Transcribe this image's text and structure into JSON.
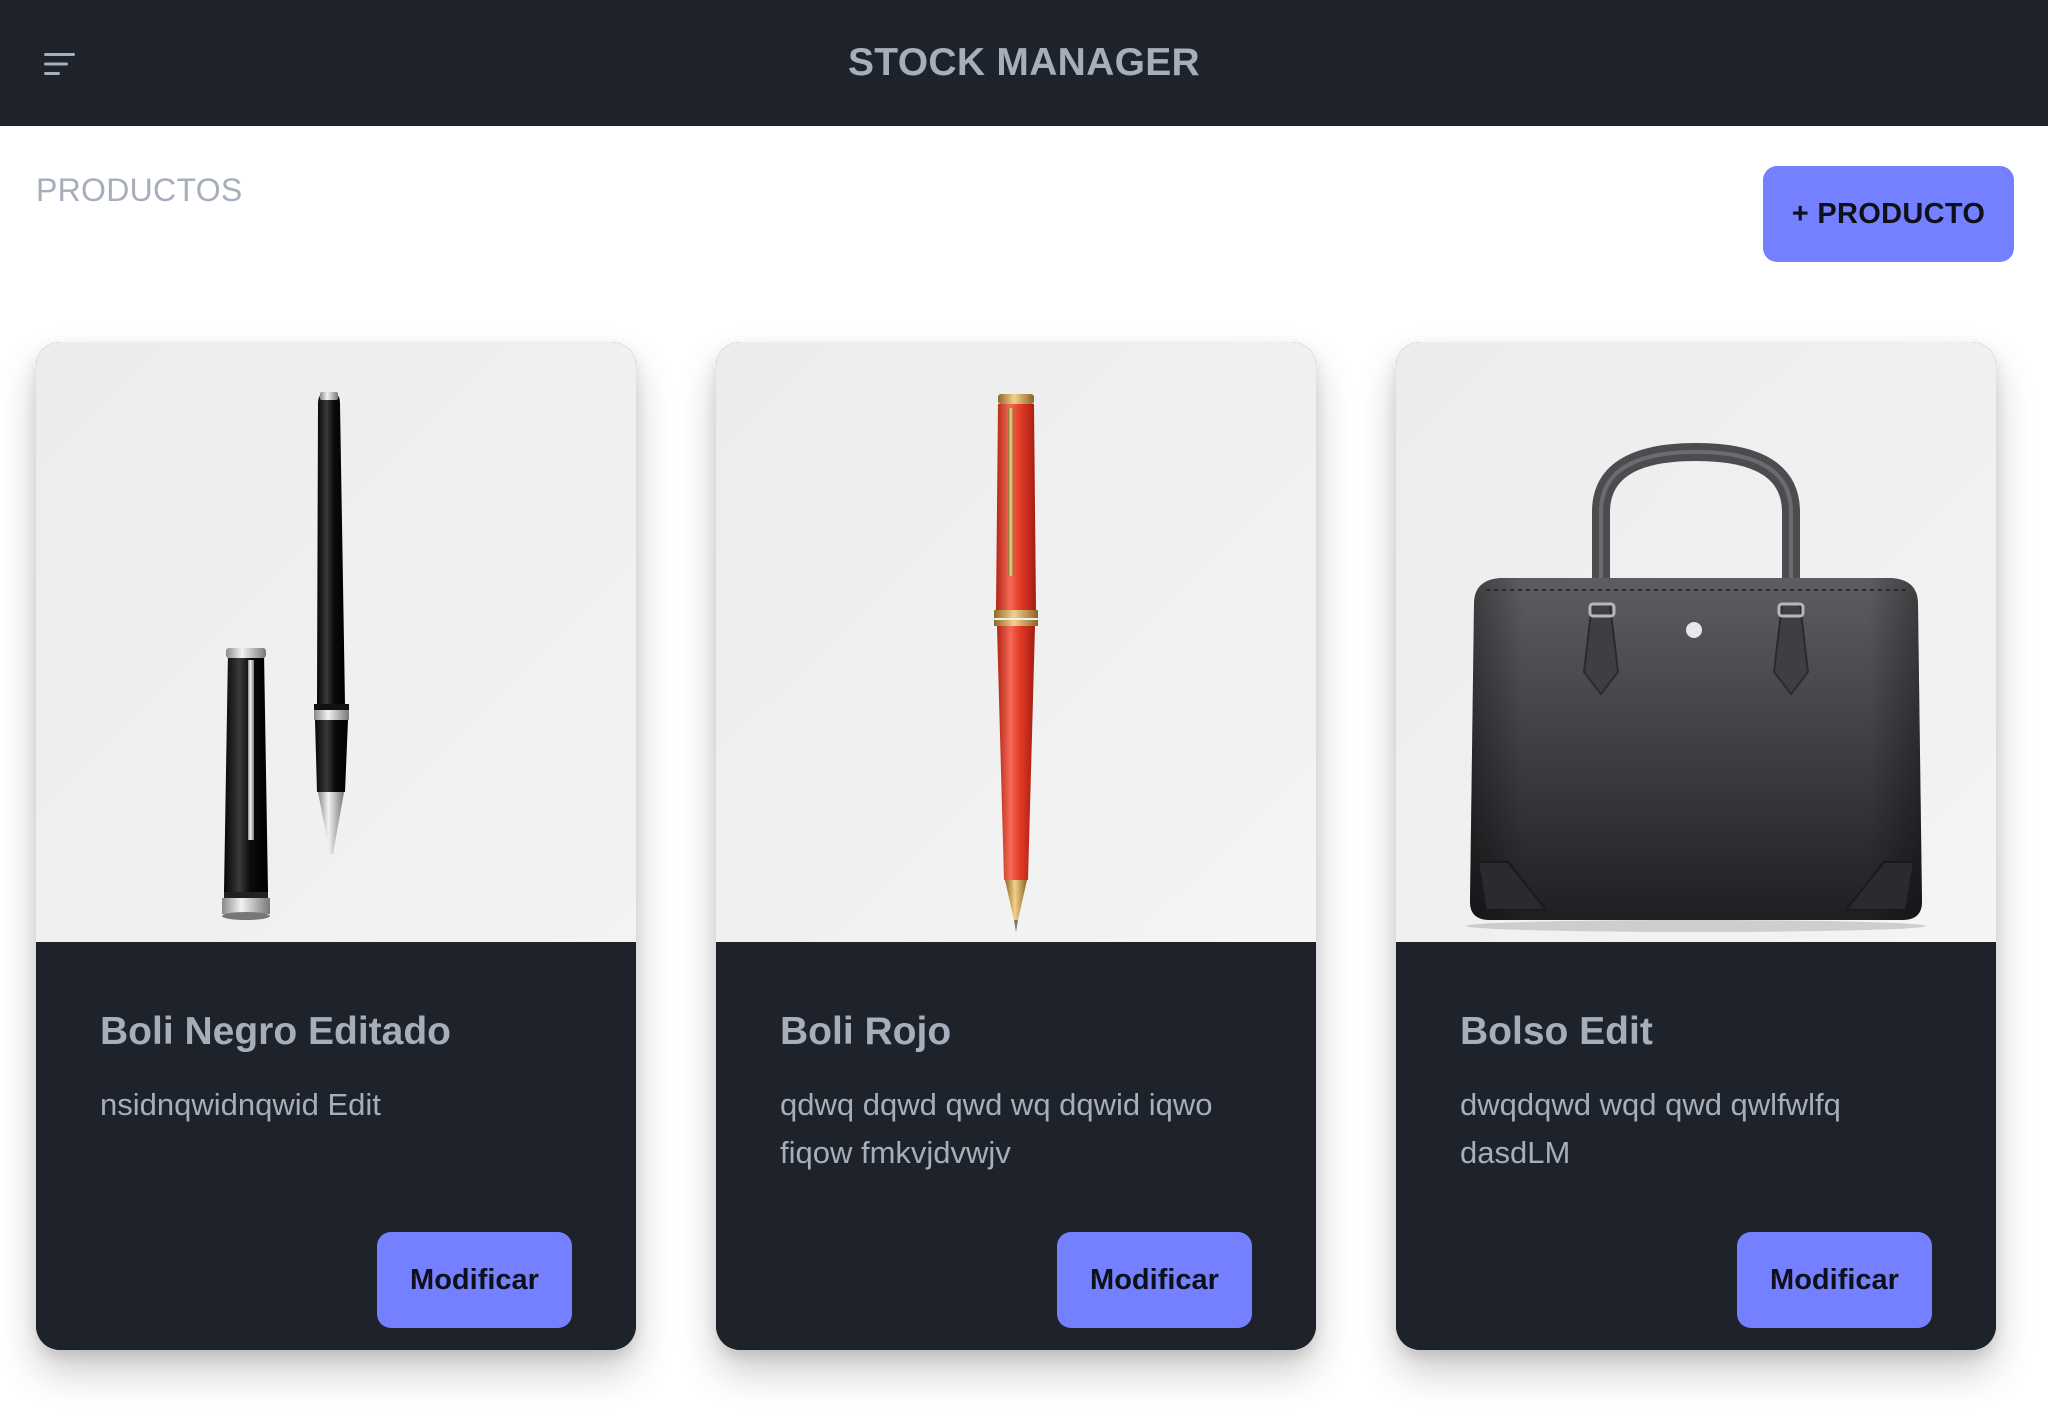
{
  "header": {
    "title": "STOCK MANAGER",
    "menu_icon": "menu-icon",
    "background": "#1d222b"
  },
  "page": {
    "section_title": "PRODUCTOS",
    "add_button_label": "+ PRODUCTO"
  },
  "accent_color": "#7480ff",
  "products": [
    {
      "name": "Boli Negro Editado",
      "description": "nsidnqwidnqwid Edit",
      "button_label": "Modificar",
      "image": "black-pen-with-cap-icon"
    },
    {
      "name": "Boli Rojo",
      "description": "qdwq dqwd qwd wq dqwid iqwo fiqow fmkvjdvwjv",
      "button_label": "Modificar",
      "image": "red-pen-icon"
    },
    {
      "name": "Bolso Edit",
      "description": "dwqdqwd wqd qwd qwlfwlfq dasdLM",
      "button_label": "Modificar",
      "image": "leather-briefcase-icon"
    }
  ]
}
